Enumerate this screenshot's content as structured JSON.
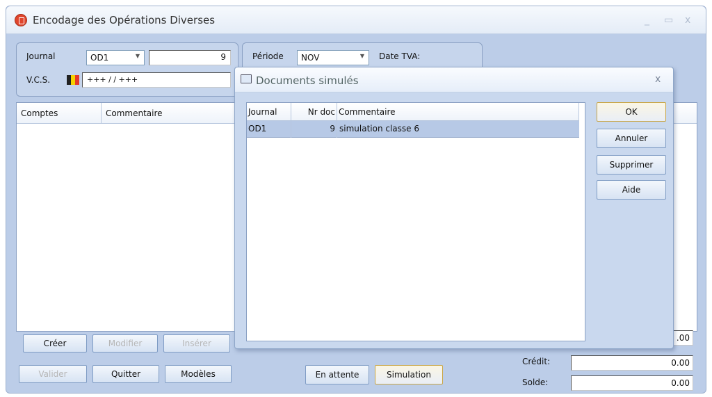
{
  "window": {
    "title": "Encodage des Opérations Diverses",
    "minimize": "_",
    "maximize": "▭",
    "close": "x"
  },
  "header": {
    "journal_label": "Journal",
    "journal_value": "OD1",
    "doc_number": "9",
    "vcs_label": "V.C.S.",
    "vcs_value": "+++ / / +++",
    "periode_label": "Période",
    "periode_value": "NOV",
    "date_tva_label": "Date TVA:"
  },
  "grid": {
    "columns": [
      "Comptes",
      "Commentaire"
    ]
  },
  "buttons": {
    "creer": "Créer",
    "modifier": "Modifier",
    "inserer": "Insérer",
    "valider": "Valider",
    "quitter": "Quitter",
    "modeles": "Modèles",
    "en_attente": "En attente",
    "simulation": "Simulation"
  },
  "totals": {
    "debit_value": ".00",
    "credit_label": "Crédit:",
    "credit_value": "0.00",
    "solde_label": "Solde:",
    "solde_value": "0.00"
  },
  "dialog": {
    "title": "Documents simulés",
    "close": "x",
    "columns": {
      "journal": "Journal",
      "nr_doc": "Nr doc",
      "commentaire": "Commentaire"
    },
    "rows": [
      {
        "journal": "OD1",
        "nr_doc": "9",
        "commentaire": "simulation classe 6"
      }
    ],
    "buttons": {
      "ok": "OK",
      "annuler": "Annuler",
      "supprimer": "Supprimer",
      "aide": "Aide"
    }
  },
  "colors": {
    "window_bg": "#bccde8",
    "selection": "#b7c9e6",
    "app_icon": "#e0452d"
  }
}
